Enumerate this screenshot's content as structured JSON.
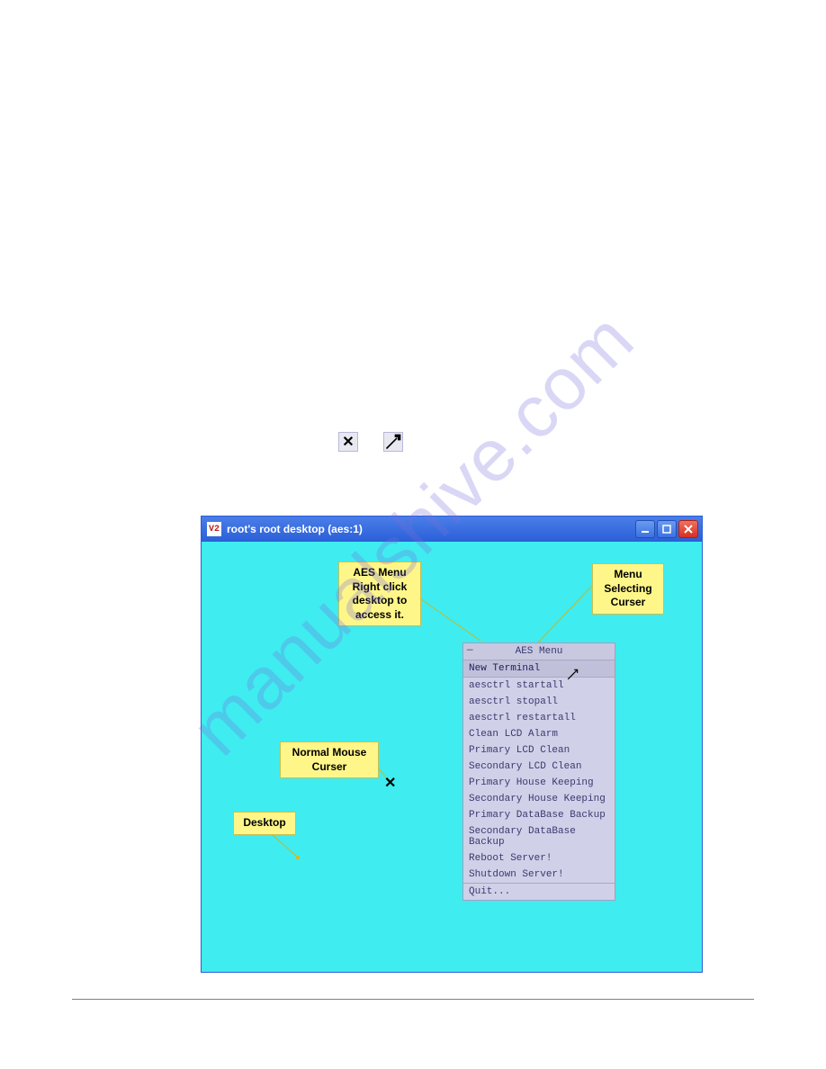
{
  "watermark": "manualshive.com",
  "window": {
    "title": "root's root desktop (aes:1)",
    "app_icon_text": "V2"
  },
  "callouts": {
    "aes_menu_note": "AES Menu Right click desktop to access it.",
    "menu_cursor_note": "Menu Selecting Curser",
    "normal_cursor_note": "Normal Mouse Curser",
    "desktop_note": "Desktop"
  },
  "menu": {
    "title": "AES Menu",
    "items": [
      "New Terminal",
      "aesctrl startall",
      "aesctrl stopall",
      "aesctrl restartall",
      "Clean LCD Alarm",
      "Primary LCD Clean",
      "Secondary LCD Clean",
      "Primary House Keeping",
      "Secondary House Keeping",
      "Primary DataBase Backup",
      "Secondary DataBase Backup",
      "Reboot Server!",
      "Shutdown Server!",
      "Quit..."
    ]
  },
  "cursors": {
    "x_glyph": "✕"
  }
}
